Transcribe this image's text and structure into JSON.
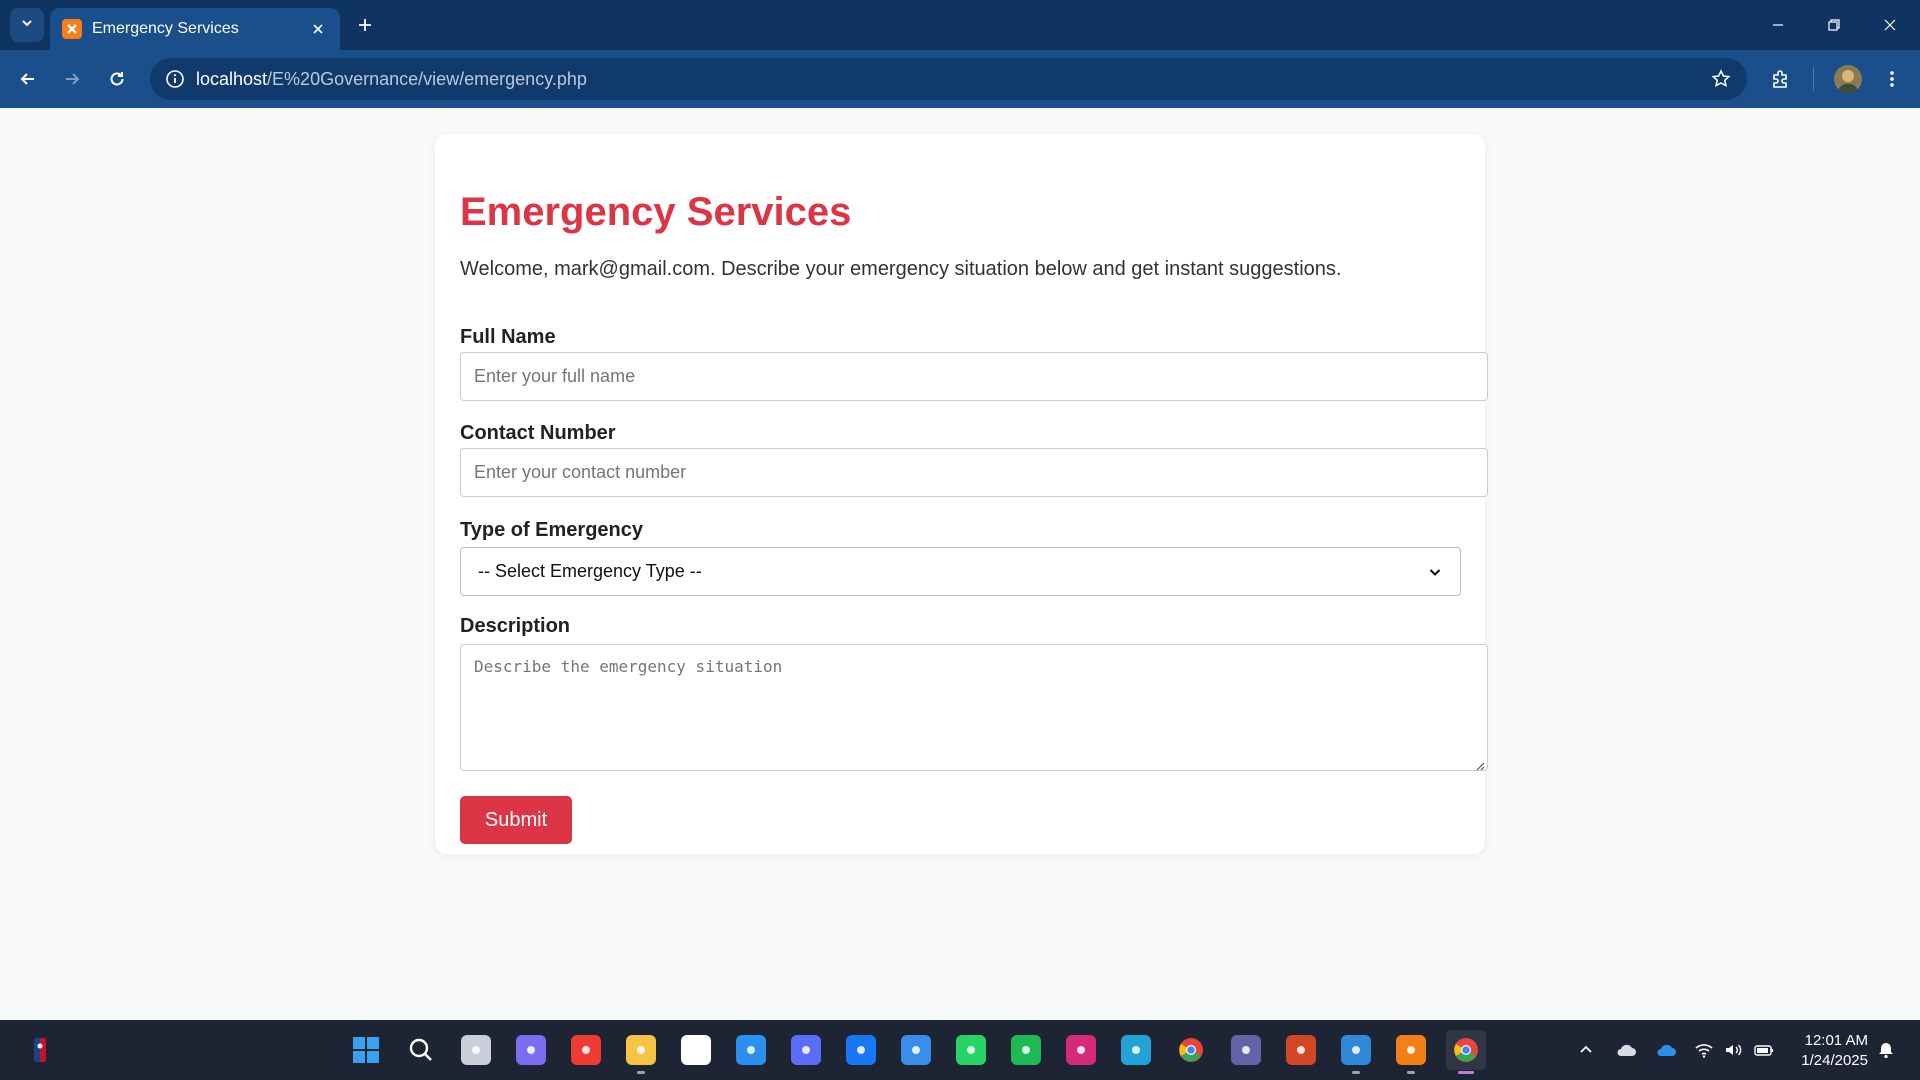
{
  "browser": {
    "tab": {
      "title": "Emergency Services"
    },
    "address_bar": {
      "host": "localhost",
      "path": "/E%20Governance/view/emergency.php"
    }
  },
  "form": {
    "title": "Emergency Services",
    "welcome": "Welcome, mark@gmail.com. Describe your emergency situation below and get instant suggestions.",
    "full_name": {
      "label": "Full Name",
      "placeholder": "Enter your full name",
      "value": ""
    },
    "contact_number": {
      "label": "Contact Number",
      "placeholder": "Enter your contact number",
      "value": ""
    },
    "emergency_type": {
      "label": "Type of Emergency",
      "selected": "-- Select Emergency Type --"
    },
    "description": {
      "label": "Description",
      "placeholder": "Describe the emergency situation",
      "value": ""
    },
    "submit_label": "Submit"
  },
  "taskbar": {
    "clock": {
      "time": "12:01 AM",
      "date": "1/24/2025"
    },
    "apps": [
      {
        "name": "windows-start-icon",
        "color": "#3aa0f0"
      },
      {
        "name": "search-icon",
        "color": "#ffffff"
      },
      {
        "name": "task-view-icon",
        "color": "#c9ced8"
      },
      {
        "name": "copilot-icon",
        "color": "#7b6cf0"
      },
      {
        "name": "anydesk-icon",
        "color": "#ef3b36"
      },
      {
        "name": "file-explorer-icon",
        "color": "#f6c344"
      },
      {
        "name": "microsoft-store-icon",
        "color": "#ffffff"
      },
      {
        "name": "get-help-icon",
        "color": "#2b8ff0"
      },
      {
        "name": "messenger-icon",
        "color": "#5b6cf7"
      },
      {
        "name": "facebook-icon",
        "color": "#1877f2"
      },
      {
        "name": "remote-app-icon",
        "color": "#3a8de8"
      },
      {
        "name": "whatsapp-icon",
        "color": "#25d366"
      },
      {
        "name": "spotify-icon",
        "color": "#1db954"
      },
      {
        "name": "instagram-icon",
        "color": "#d6297a"
      },
      {
        "name": "edge-icon",
        "color": "#20a4d6"
      },
      {
        "name": "chrome-icon",
        "color": "#e8453c"
      },
      {
        "name": "teams-icon",
        "color": "#6264a7"
      },
      {
        "name": "powerpoint-icon",
        "color": "#d24726"
      },
      {
        "name": "vscode-icon",
        "color": "#2f88d8"
      },
      {
        "name": "xampp-icon",
        "color": "#f57f17"
      },
      {
        "name": "chrome-profile-icon",
        "color": "#e8453c"
      }
    ]
  }
}
